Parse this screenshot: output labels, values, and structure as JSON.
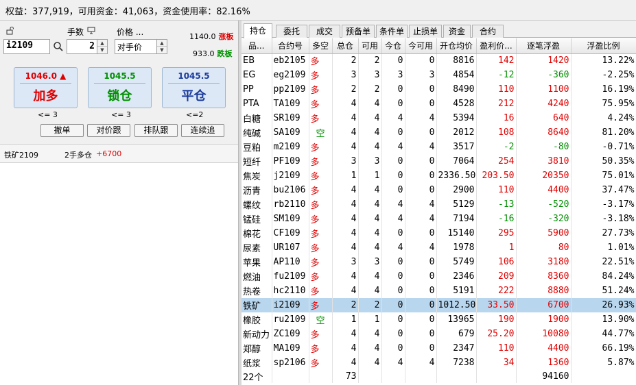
{
  "summary": "权益：377,919，可用资金：41,063，资金使用率：82.16%",
  "order": {
    "contract": "i2109",
    "qty_label": "手数",
    "qty": "2",
    "price_label": "价格 ...",
    "price_mode": "对手价",
    "limit_up": "1140.0",
    "limit_up_tag": "涨板",
    "limit_down": "933.0",
    "limit_down_tag": "跌板",
    "buttons": [
      {
        "price": "1046.0",
        "label": "加多",
        "limit": "<= 3"
      },
      {
        "price": "1045.5",
        "label": "锁仓",
        "limit": "<= 3"
      },
      {
        "price": "1045.5",
        "label": "平仓",
        "limit": "<=2"
      }
    ],
    "small_buttons": [
      "撤单",
      "对价跟",
      "排队跟",
      "连续追"
    ],
    "position_name": "铁矿2109",
    "position_desc": "2手多仓",
    "position_pnl": "+6700"
  },
  "tabs": [
    "持仓",
    "委托",
    "成交",
    "预备单",
    "条件单",
    "止损单",
    "资金",
    "合约"
  ],
  "active_tab": 0,
  "columns": [
    "品...",
    "合约号",
    "多空",
    "总仓",
    "可用",
    "今仓",
    "今可用",
    "开仓均价",
    "盈利价...",
    "逐笔浮盈",
    "浮盈比例"
  ],
  "rows": [
    {
      "name": "EB",
      "code": "eb2105",
      "dir": "多",
      "total": "2",
      "avail": "2",
      "today": "0",
      "today_avail": "0",
      "avg": "8816",
      "pnl_price": "142",
      "float_pnl": "1420",
      "ratio": "13.22%",
      "sign": "pos"
    },
    {
      "name": "EG",
      "code": "eg2109",
      "dir": "多",
      "total": "3",
      "avail": "3",
      "today": "3",
      "today_avail": "3",
      "avg": "4854",
      "pnl_price": "-12",
      "float_pnl": "-360",
      "ratio": "-2.25%",
      "sign": "neg"
    },
    {
      "name": "PP",
      "code": "pp2109",
      "dir": "多",
      "total": "2",
      "avail": "2",
      "today": "0",
      "today_avail": "0",
      "avg": "8490",
      "pnl_price": "110",
      "float_pnl": "1100",
      "ratio": "16.19%",
      "sign": "pos"
    },
    {
      "name": "PTA",
      "code": "TA109",
      "dir": "多",
      "total": "4",
      "avail": "4",
      "today": "0",
      "today_avail": "0",
      "avg": "4528",
      "pnl_price": "212",
      "float_pnl": "4240",
      "ratio": "75.95%",
      "sign": "pos"
    },
    {
      "name": "白糖",
      "code": "SR109",
      "dir": "多",
      "total": "4",
      "avail": "4",
      "today": "4",
      "today_avail": "4",
      "avg": "5394",
      "pnl_price": "16",
      "float_pnl": "640",
      "ratio": "4.24%",
      "sign": "pos"
    },
    {
      "name": "纯碱",
      "code": "SA109",
      "dir": "空",
      "total": "4",
      "avail": "4",
      "today": "0",
      "today_avail": "0",
      "avg": "2012",
      "pnl_price": "108",
      "float_pnl": "8640",
      "ratio": "81.20%",
      "sign": "pos"
    },
    {
      "name": "豆粕",
      "code": "m2109",
      "dir": "多",
      "total": "4",
      "avail": "4",
      "today": "4",
      "today_avail": "4",
      "avg": "3517",
      "pnl_price": "-2",
      "float_pnl": "-80",
      "ratio": "-0.71%",
      "sign": "neg"
    },
    {
      "name": "短纤",
      "code": "PF109",
      "dir": "多",
      "total": "3",
      "avail": "3",
      "today": "0",
      "today_avail": "0",
      "avg": "7064",
      "pnl_price": "254",
      "float_pnl": "3810",
      "ratio": "50.35%",
      "sign": "pos"
    },
    {
      "name": "焦炭",
      "code": "j2109",
      "dir": "多",
      "total": "1",
      "avail": "1",
      "today": "0",
      "today_avail": "0",
      "avg": "2336.50",
      "pnl_price": "203.50",
      "float_pnl": "20350",
      "ratio": "75.01%",
      "sign": "pos"
    },
    {
      "name": "沥青",
      "code": "bu2106",
      "dir": "多",
      "total": "4",
      "avail": "4",
      "today": "0",
      "today_avail": "0",
      "avg": "2900",
      "pnl_price": "110",
      "float_pnl": "4400",
      "ratio": "37.47%",
      "sign": "pos"
    },
    {
      "name": "螺纹",
      "code": "rb2110",
      "dir": "多",
      "total": "4",
      "avail": "4",
      "today": "4",
      "today_avail": "4",
      "avg": "5129",
      "pnl_price": "-13",
      "float_pnl": "-520",
      "ratio": "-3.17%",
      "sign": "neg"
    },
    {
      "name": "锰硅",
      "code": "SM109",
      "dir": "多",
      "total": "4",
      "avail": "4",
      "today": "4",
      "today_avail": "4",
      "avg": "7194",
      "pnl_price": "-16",
      "float_pnl": "-320",
      "ratio": "-3.18%",
      "sign": "neg"
    },
    {
      "name": "棉花",
      "code": "CF109",
      "dir": "多",
      "total": "4",
      "avail": "4",
      "today": "0",
      "today_avail": "0",
      "avg": "15140",
      "pnl_price": "295",
      "float_pnl": "5900",
      "ratio": "27.73%",
      "sign": "pos"
    },
    {
      "name": "尿素",
      "code": "UR107",
      "dir": "多",
      "total": "4",
      "avail": "4",
      "today": "4",
      "today_avail": "4",
      "avg": "1978",
      "pnl_price": "1",
      "float_pnl": "80",
      "ratio": "1.01%",
      "sign": "pos"
    },
    {
      "name": "苹果",
      "code": "AP110",
      "dir": "多",
      "total": "3",
      "avail": "3",
      "today": "0",
      "today_avail": "0",
      "avg": "5749",
      "pnl_price": "106",
      "float_pnl": "3180",
      "ratio": "22.51%",
      "sign": "pos"
    },
    {
      "name": "燃油",
      "code": "fu2109",
      "dir": "多",
      "total": "4",
      "avail": "4",
      "today": "0",
      "today_avail": "0",
      "avg": "2346",
      "pnl_price": "209",
      "float_pnl": "8360",
      "ratio": "84.24%",
      "sign": "pos"
    },
    {
      "name": "热卷",
      "code": "hc2110",
      "dir": "多",
      "total": "4",
      "avail": "4",
      "today": "0",
      "today_avail": "0",
      "avg": "5191",
      "pnl_price": "222",
      "float_pnl": "8880",
      "ratio": "51.24%",
      "sign": "pos"
    },
    {
      "name": "铁矿",
      "code": "i2109",
      "dir": "多",
      "total": "2",
      "avail": "2",
      "today": "0",
      "today_avail": "0",
      "avg": "1012.50",
      "pnl_price": "33.50",
      "float_pnl": "6700",
      "ratio": "26.93%",
      "sign": "pos",
      "selected": true
    },
    {
      "name": "橡胶",
      "code": "ru2109",
      "dir": "空",
      "total": "1",
      "avail": "1",
      "today": "0",
      "today_avail": "0",
      "avg": "13965",
      "pnl_price": "190",
      "float_pnl": "1900",
      "ratio": "13.90%",
      "sign": "pos"
    },
    {
      "name": "新动力",
      "code": "ZC109",
      "dir": "多",
      "total": "4",
      "avail": "4",
      "today": "0",
      "today_avail": "0",
      "avg": "679",
      "pnl_price": "25.20",
      "float_pnl": "10080",
      "ratio": "44.77%",
      "sign": "pos"
    },
    {
      "name": "郑醇",
      "code": "MA109",
      "dir": "多",
      "total": "4",
      "avail": "4",
      "today": "0",
      "today_avail": "0",
      "avg": "2347",
      "pnl_price": "110",
      "float_pnl": "4400",
      "ratio": "66.19%",
      "sign": "pos"
    },
    {
      "name": "纸浆",
      "code": "sp2106",
      "dir": "多",
      "total": "4",
      "avail": "4",
      "today": "4",
      "today_avail": "4",
      "avg": "7238",
      "pnl_price": "34",
      "float_pnl": "1360",
      "ratio": "5.87%",
      "sign": "pos"
    }
  ],
  "totals": {
    "count": "22个",
    "total": "73",
    "float_pnl": "94160"
  },
  "colors": {
    "red": "#e00000",
    "green": "#009000",
    "selected": "#b8d6ee",
    "button_bg": "#dce8f5"
  }
}
